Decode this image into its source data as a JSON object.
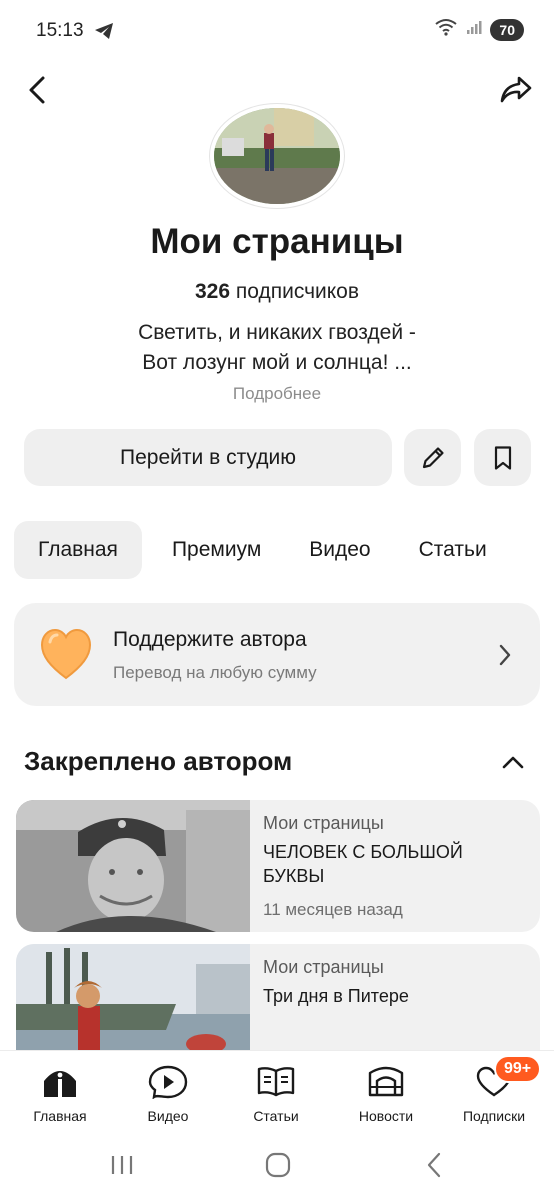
{
  "status_bar": {
    "time": "15:13",
    "battery": "70"
  },
  "channel": {
    "title": "Мои страницы",
    "subscribers_count": "326",
    "subscribers_label": "подписчиков",
    "description_line1": "Светить, и никаких гвоздей -",
    "description_line2": "Вот лозунг мой и солнца! ...",
    "more_label": "Подробнее"
  },
  "actions": {
    "studio_label": "Перейти в студию"
  },
  "tabs": [
    {
      "label": "Главная",
      "active": true
    },
    {
      "label": "Премиум",
      "active": false
    },
    {
      "label": "Видео",
      "active": false
    },
    {
      "label": "Статьи",
      "active": false
    }
  ],
  "support": {
    "title": "Поддержите автора",
    "subtitle": "Перевод на любую сумму"
  },
  "pinned": {
    "title": "Закреплено автором",
    "items": [
      {
        "channel": "Мои страницы",
        "title": "ЧЕЛОВЕК С БОЛЬШОЙ БУКВЫ",
        "meta": "11 месяцев назад"
      },
      {
        "channel": "Мои страницы",
        "title": "Три дня в Питере",
        "meta": ""
      }
    ]
  },
  "bottom_nav": [
    {
      "label": "Главная",
      "icon": "home-icon"
    },
    {
      "label": "Видео",
      "icon": "video-icon"
    },
    {
      "label": "Статьи",
      "icon": "articles-icon"
    },
    {
      "label": "Новости",
      "icon": "news-icon"
    },
    {
      "label": "Подписки",
      "icon": "subscriptions-icon",
      "badge": "99+"
    }
  ],
  "colors": {
    "accent_badge": "#ff5a1f",
    "card_background": "#f1f1f1",
    "heart": "#ffb35c"
  }
}
